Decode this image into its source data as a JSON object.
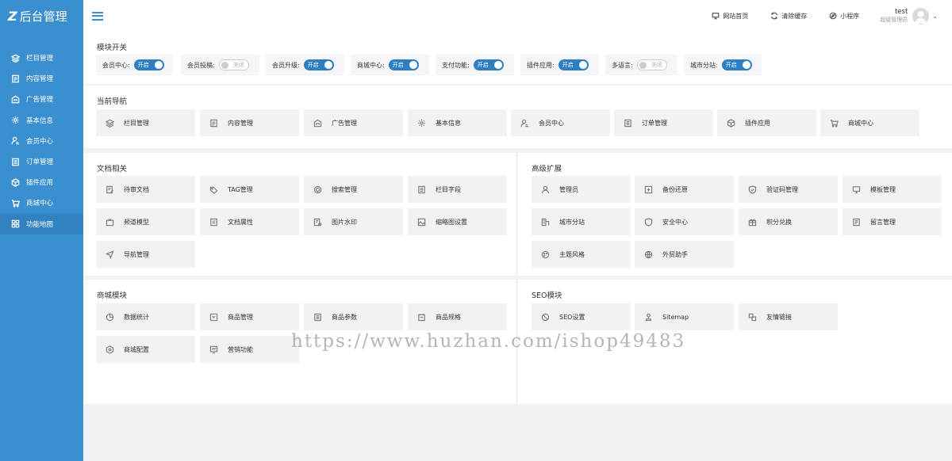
{
  "brand": {
    "logo_mark": "Z",
    "title": "后台管理"
  },
  "sidebar": {
    "items": [
      {
        "label": "栏目管理",
        "icon": "layers-icon"
      },
      {
        "label": "内容管理",
        "icon": "document-icon"
      },
      {
        "label": "广告管理",
        "icon": "ad-icon"
      },
      {
        "label": "基本信息",
        "icon": "gear-icon"
      },
      {
        "label": "会员中心",
        "icon": "user-icon"
      },
      {
        "label": "订单管理",
        "icon": "list-icon"
      },
      {
        "label": "插件应用",
        "icon": "cube-icon"
      },
      {
        "label": "商城中心",
        "icon": "cart-icon"
      },
      {
        "label": "功能地图",
        "icon": "grid-icon",
        "active": true
      }
    ]
  },
  "header": {
    "links": [
      {
        "label": "网站首页",
        "icon": "monitor-icon"
      },
      {
        "label": "清除缓存",
        "icon": "refresh-icon"
      },
      {
        "label": "小程序",
        "icon": "compass-icon"
      }
    ],
    "user": {
      "name": "test",
      "role": "超级管理员"
    }
  },
  "modules": {
    "title": "模块开关",
    "items": [
      {
        "label": "会员中心:",
        "state": "开启",
        "on": true
      },
      {
        "label": "会员投稿:",
        "state": "关闭",
        "on": false
      },
      {
        "label": "会员升级:",
        "state": "开启",
        "on": true
      },
      {
        "label": "商城中心:",
        "state": "开启",
        "on": true
      },
      {
        "label": "支付功能:",
        "state": "开启",
        "on": true
      },
      {
        "label": "插件应用:",
        "state": "开启",
        "on": true
      },
      {
        "label": "多语言:",
        "state": "关闭",
        "on": false
      },
      {
        "label": "城市分站:",
        "state": "开启",
        "on": true
      }
    ]
  },
  "current_nav": {
    "title": "当前导航",
    "items": [
      {
        "label": "栏目管理",
        "icon": "layers-icon"
      },
      {
        "label": "内容管理",
        "icon": "document-icon"
      },
      {
        "label": "广告管理",
        "icon": "ad-icon"
      },
      {
        "label": "基本信息",
        "icon": "gear-icon"
      },
      {
        "label": "会员中心",
        "icon": "user-icon"
      },
      {
        "label": "订单管理",
        "icon": "list-icon"
      },
      {
        "label": "插件应用",
        "icon": "cube-icon"
      },
      {
        "label": "商城中心",
        "icon": "cart-icon"
      }
    ]
  },
  "docs": {
    "title": "文档相关",
    "items": [
      {
        "label": "待审文档",
        "icon": "edit-doc-icon"
      },
      {
        "label": "TAG管理",
        "icon": "tag-icon"
      },
      {
        "label": "搜索管理",
        "icon": "search-icon"
      },
      {
        "label": "栏目字段",
        "icon": "fields-icon"
      },
      {
        "label": "频道模型",
        "icon": "tv-icon"
      },
      {
        "label": "文档属性",
        "icon": "doc-attr-icon"
      },
      {
        "label": "图片水印",
        "icon": "image-icon"
      },
      {
        "label": "缩略图设置",
        "icon": "thumbnail-icon"
      },
      {
        "label": "导航管理",
        "icon": "navigation-icon"
      }
    ]
  },
  "advanced": {
    "title": "高级扩展",
    "items": [
      {
        "label": "管理员",
        "icon": "admin-icon"
      },
      {
        "label": "备份还原",
        "icon": "backup-icon"
      },
      {
        "label": "验证码管理",
        "icon": "shield-icon"
      },
      {
        "label": "模板管理",
        "icon": "monitor-icon"
      },
      {
        "label": "城市分站",
        "icon": "building-icon"
      },
      {
        "label": "安全中心",
        "icon": "security-icon"
      },
      {
        "label": "积分兑换",
        "icon": "gift-icon"
      },
      {
        "label": "留言管理",
        "icon": "message-icon"
      },
      {
        "label": "主题风格",
        "icon": "palette-icon"
      },
      {
        "label": "外贸助手",
        "icon": "globe-icon"
      }
    ]
  },
  "shop": {
    "title": "商城模块",
    "items": [
      {
        "label": "数据统计",
        "icon": "pie-chart-icon"
      },
      {
        "label": "商品管理",
        "icon": "product-icon"
      },
      {
        "label": "商品参数",
        "icon": "params-icon"
      },
      {
        "label": "商品规格",
        "icon": "spec-icon"
      },
      {
        "label": "商城配置",
        "icon": "shop-config-icon"
      },
      {
        "label": "营销功能",
        "icon": "marketing-icon"
      }
    ]
  },
  "seo": {
    "title": "SEO模块",
    "items": [
      {
        "label": "SEO设置",
        "icon": "seo-icon"
      },
      {
        "label": "Sitemap",
        "icon": "sitemap-icon"
      },
      {
        "label": "友情链接",
        "icon": "link-icon"
      }
    ]
  },
  "watermark": "https://www.huzhan.com/ishop49483"
}
